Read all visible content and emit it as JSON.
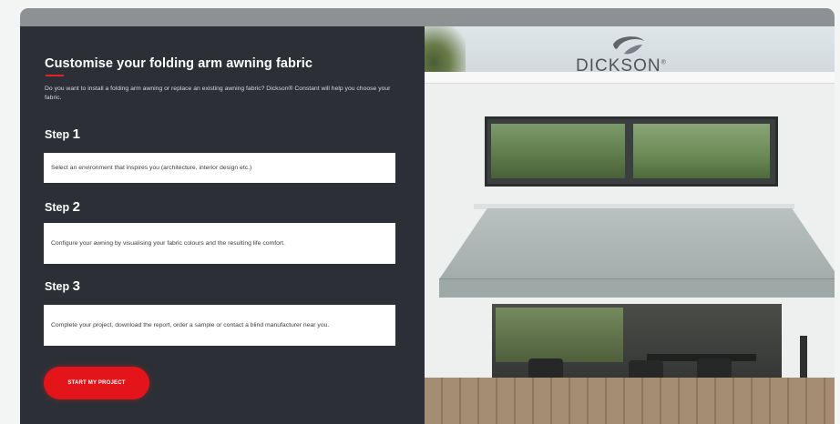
{
  "hero": {
    "title": "Customise your folding arm awning fabric",
    "intro": "Do you want to install a folding arm awning or replace an existing awning fabric? Dickson® Constant will help you choose your fabric.",
    "steps": [
      {
        "label": "Step",
        "number": "1",
        "text": "Select an environment that inspires you (architecture, interior design etc.)"
      },
      {
        "label": "Step",
        "number": "2",
        "text": "Configure your awning by visualising your fabric colours and the resulting life comfort."
      },
      {
        "label": "Step",
        "number": "3",
        "text": "Complete your project, download the report, order a sample or contact a blind manufacturer near you."
      }
    ],
    "cta_label": "START MY PROJECT"
  },
  "brand": {
    "logo_text": "DICKSON",
    "logo_mark": "®",
    "accent": "#e4141b",
    "panel_bg": "#2c3036"
  },
  "image": {
    "icon": "house-awning-photo"
  }
}
